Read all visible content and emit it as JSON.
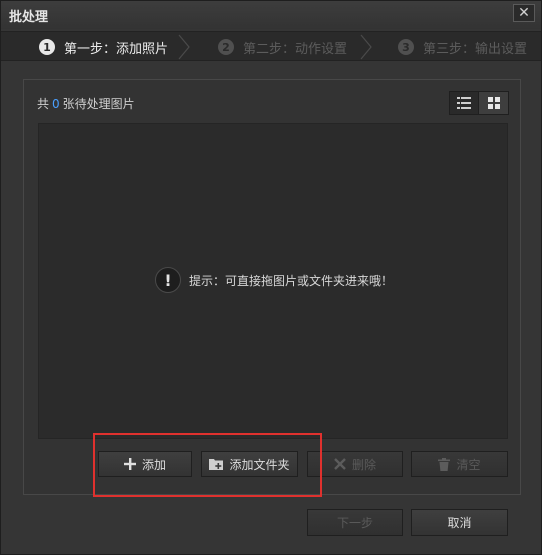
{
  "window": {
    "title": "批处理",
    "close_label": "✕"
  },
  "steps": [
    {
      "num": "1",
      "label": "第一步：添加照片",
      "state": "active"
    },
    {
      "num": "2",
      "label": "第二步：动作设置",
      "state": "inactive"
    },
    {
      "num": "3",
      "label": "第三步：输出设置",
      "state": "inactive"
    }
  ],
  "panel": {
    "count_prefix": "共",
    "count": "0",
    "count_suffix": "张待处理图片",
    "hint_icon": "!",
    "hint_text": "提示：可直接拖图片或文件夹进来哦！"
  },
  "actions": {
    "add_label": "添加",
    "add_folder_label": "添加文件夹",
    "delete_label": "删除",
    "clear_label": "清空"
  },
  "footer": {
    "next_label": "下一步",
    "cancel_label": "取消"
  },
  "colors": {
    "accent": "#4aa0ff",
    "highlight": "#e0312e"
  }
}
